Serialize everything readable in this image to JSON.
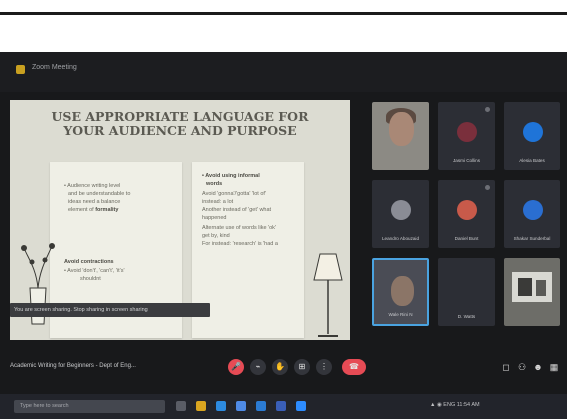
{
  "window": {
    "title": "Zoom Meeting"
  },
  "slide": {
    "title_line1": "USE APPROPRIATE LANGUAGE FOR",
    "title_line2": "YOUR AUDIENCE AND PURPOSE",
    "left": {
      "bullet1_l1": "• Audience writing level",
      "bullet1_l2": "and be understandable to",
      "bullet1_l3": "ideas need a balance",
      "bullet1_l4": "element of",
      "bullet1_bold": "formality",
      "subhead": "Avoid contractions",
      "bullet2_l1": "• Avoid 'don't', 'can't', 'it's'",
      "bullet2_l2": "shouldnt"
    },
    "right": {
      "subhead_l1": "• Avoid using informal",
      "subhead_l2": "words",
      "l1": "Avoid 'gonna'/'gotta' 'lot of'",
      "l2": "instead: a lot",
      "l3": "Another instead of 'get' what",
      "l4": "happened",
      "l5": "Alternate use of words like 'ok'",
      "l6": "get by, kind",
      "l7": "For instead: 'research' is 'had a"
    }
  },
  "caption": "You are screen sharing. Stop sharing in screen sharing",
  "participants": [
    {
      "name": "",
      "type": "video"
    },
    {
      "name": "Jasmi Collins",
      "type": "avatar",
      "color": "#7a2f3c"
    },
    {
      "name": "Alesia Bates",
      "type": "avatar",
      "color": "#1f74d8"
    },
    {
      "name": "Leandro Abouzaid",
      "type": "avatar",
      "color": "#8a8c95"
    },
    {
      "name": "Daniel Bunt",
      "type": "avatar",
      "color": "#c85a4a"
    },
    {
      "name": "Shakar Sunderbal",
      "type": "avatar",
      "color": "#2a6ed1"
    },
    {
      "name": "Wale Rini N",
      "type": "video-active"
    },
    {
      "name": "D. Watts",
      "type": "blank"
    },
    {
      "name": "",
      "type": "video"
    }
  ],
  "meeting": {
    "info": "Academic Writing for Beginners - Dept of Eng..."
  },
  "controls": {
    "mic_icon": "mic-off-icon",
    "cam_icon": "camera-icon",
    "hand_icon": "raise-hand-icon",
    "apps_icon": "apps-grid-icon",
    "more_icon": "more-icon",
    "end_icon": "end-call-icon",
    "glyph_mic": "🎤",
    "glyph_cam": "⌁",
    "glyph_hand": "✋",
    "glyph_apps": "⊞",
    "glyph_more": "⋮",
    "glyph_end": "☎"
  },
  "right_tools": {
    "glyph_chat": "◻",
    "glyph_people": "⚇",
    "glyph_react": "☻",
    "glyph_apps": "▦"
  },
  "taskbar": {
    "search_placeholder": "Type here to search",
    "tray_text": "▲ ◉ ENG  11:54 AM"
  }
}
